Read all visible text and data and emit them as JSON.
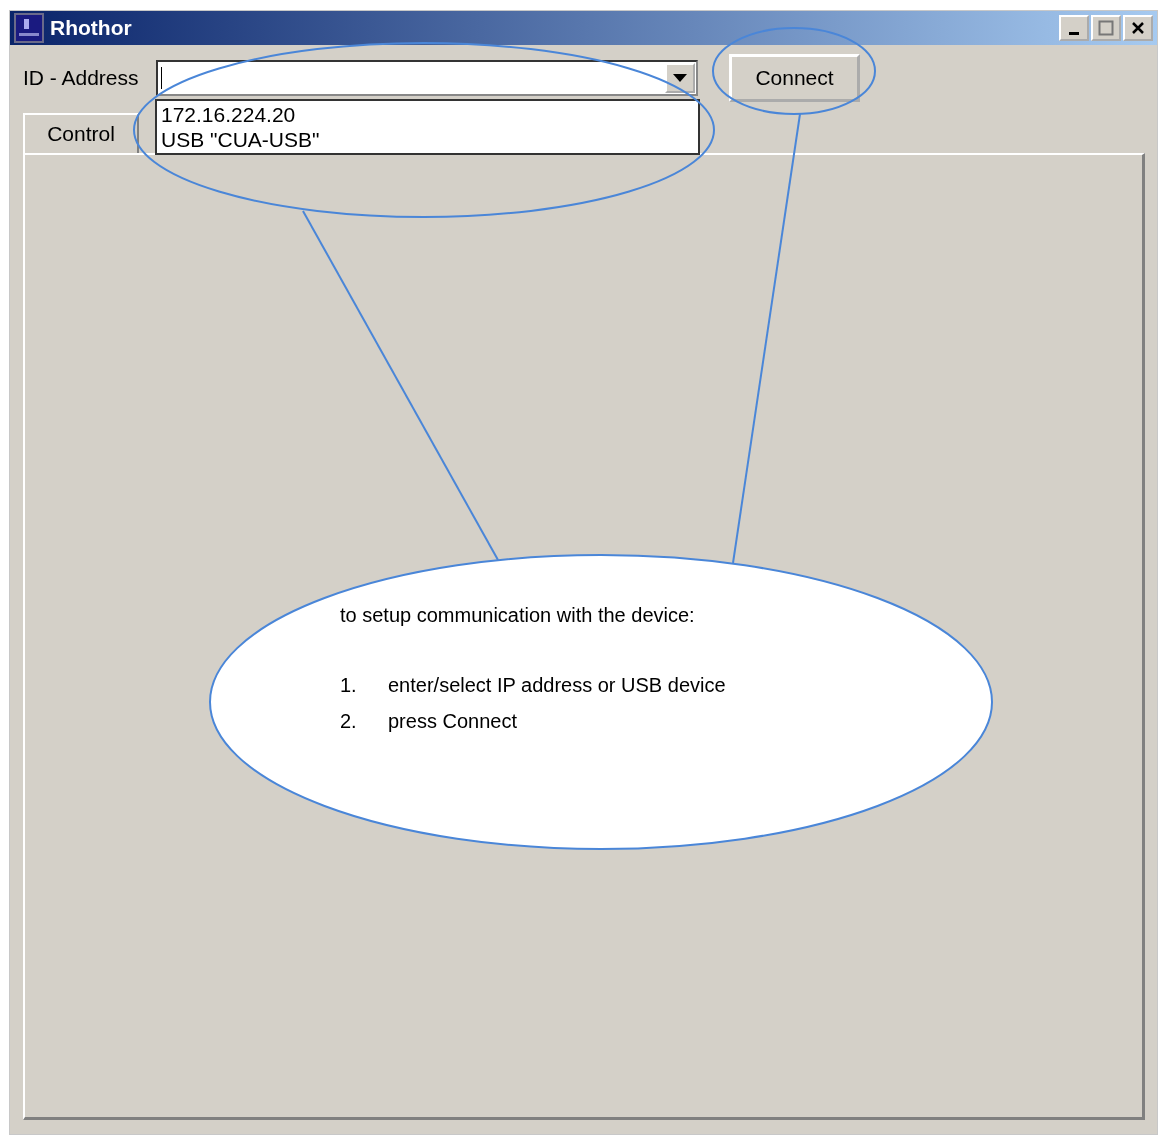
{
  "window": {
    "title": "Rhothor"
  },
  "address": {
    "label": "ID - Address",
    "options": [
      "172.16.224.20",
      "USB \"CUA-USB\""
    ]
  },
  "connect_button": {
    "label": "Connect"
  },
  "tabs": [
    {
      "label": "Control",
      "selected": true
    }
  ],
  "callout": {
    "heading": "to setup communication with the device:",
    "steps": [
      {
        "number": "1.",
        "text": "enter/select IP address or USB device"
      },
      {
        "number": "2.",
        "text": "press Connect"
      }
    ]
  }
}
